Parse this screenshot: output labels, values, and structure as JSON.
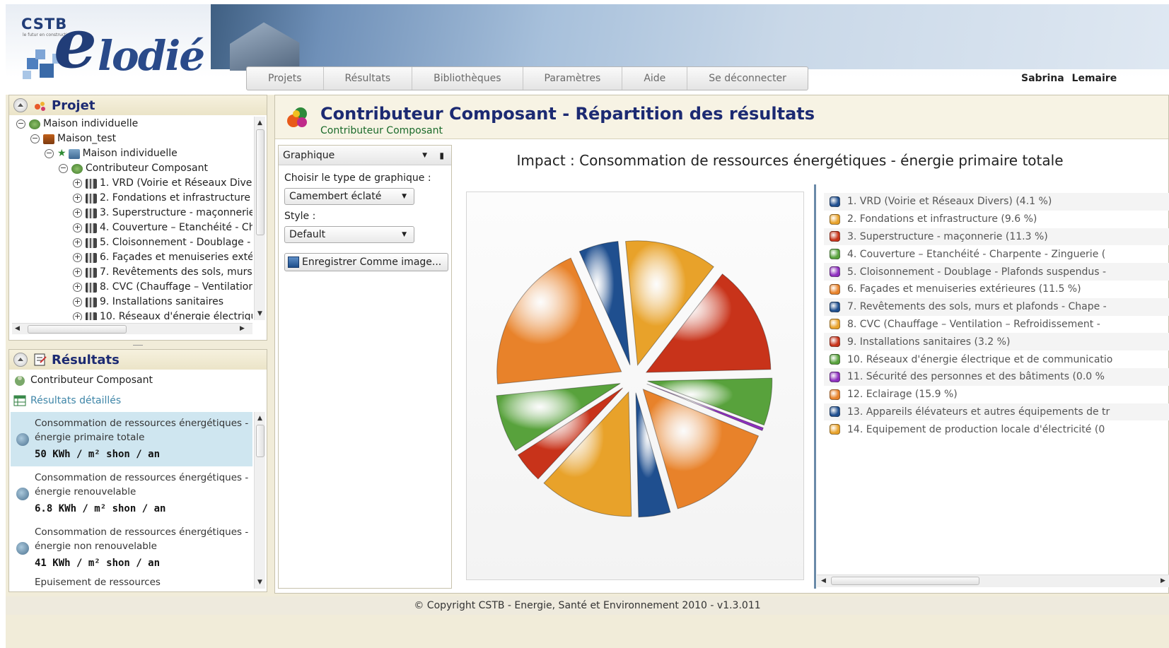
{
  "header": {
    "logo_cstb": "CSTB",
    "logo_tagline": "le futur en construction",
    "logo_e": "e",
    "logo_rest": "lodié",
    "menu": [
      "Projets",
      "Résultats",
      "Bibliothèques",
      "Paramètres",
      "Aide",
      "Se déconnecter"
    ],
    "user": "Sabrina Lemaire"
  },
  "projet": {
    "title": "Projet",
    "tree": [
      {
        "label": "Maison individuelle",
        "level": 0,
        "toggle": "⊖",
        "icon": "project-icon"
      },
      {
        "label": "Maison_test",
        "level": 1,
        "toggle": "⊖",
        "icon": "house-icon"
      },
      {
        "label": "Maison individuelle",
        "level": 2,
        "toggle": "⊖",
        "icon": "building-icon",
        "star": true
      },
      {
        "label": "Contributeur Composant",
        "level": 3,
        "toggle": "⊖",
        "icon": "component-icon"
      },
      {
        "label": "1. VRD (Voirie et Réseaux Dive",
        "level": 4,
        "toggle": "⊕",
        "icon": "book-icon"
      },
      {
        "label": "2. Fondations et infrastructure",
        "level": 4,
        "toggle": "⊕",
        "icon": "book-icon"
      },
      {
        "label": "3. Superstructure - maçonnerie",
        "level": 4,
        "toggle": "⊕",
        "icon": "book-icon"
      },
      {
        "label": "4. Couverture – Etanchéité - Ch",
        "level": 4,
        "toggle": "⊕",
        "icon": "book-icon"
      },
      {
        "label": "5. Cloisonnement - Doublage -",
        "level": 4,
        "toggle": "⊕",
        "icon": "book-icon"
      },
      {
        "label": "6. Façades et menuiseries exté",
        "level": 4,
        "toggle": "⊕",
        "icon": "book-icon"
      },
      {
        "label": "7. Revêtements des sols, murs",
        "level": 4,
        "toggle": "⊕",
        "icon": "book-icon"
      },
      {
        "label": "8. CVC (Chauffage – Ventilation",
        "level": 4,
        "toggle": "⊕",
        "icon": "book-icon"
      },
      {
        "label": "9. Installations sanitaires",
        "level": 4,
        "toggle": "⊕",
        "icon": "book-icon"
      },
      {
        "label": "10. Réseaux d'énergie électriqu",
        "level": 4,
        "toggle": "⊕",
        "icon": "book-icon"
      }
    ]
  },
  "resultats": {
    "title": "Résultats",
    "link_component": "Contributeur Composant",
    "link_detailed": "Résultats détaillés",
    "items": [
      {
        "label": "Consommation de ressources énergétiques - énergie primaire totale",
        "value": "50 KWh / m² shon / an",
        "selected": true
      },
      {
        "label": "Consommation de ressources énergétiques - énergie renouvelable",
        "value": "6.8 KWh / m² shon / an",
        "selected": false
      },
      {
        "label": "Consommation de ressources énergétiques - énergie non renouvelable",
        "value": "41 KWh / m² shon / an",
        "selected": false
      },
      {
        "label": "Epuisement de ressources",
        "value": "",
        "selected": false
      }
    ]
  },
  "main": {
    "title": "Contributeur Composant - Répartition des résultats",
    "subtitle": "Contributeur Composant",
    "options": {
      "header": "Graphique",
      "chart_type_label": "Choisir le type de graphique :",
      "chart_type_value": "Camembert éclaté",
      "style_label": "Style :",
      "style_value": "Default",
      "save_button": "Enregistrer Comme image..."
    },
    "impact_title": "Impact : Consommation de ressources énergétiques - énergie primaire totale"
  },
  "chart_data": {
    "type": "pie",
    "exploded": true,
    "title": "Impact : Consommation de ressources énergétiques - énergie primaire totale",
    "legend_position": "right",
    "slices": [
      {
        "label": "1. VRD (Voirie et Réseaux Divers) (4.1 %)",
        "value": 4.1,
        "color": "#1f4f8f"
      },
      {
        "label": "2. Fondations et infrastructure (9.6 %)",
        "value": 9.6,
        "color": "#e8a22a"
      },
      {
        "label": "3. Superstructure - maçonnerie (11.3 %)",
        "value": 11.3,
        "color": "#c8331a"
      },
      {
        "label": "4. Couverture – Etanchéité - Charpente - Zinguerie (",
        "value": 4.9,
        "color": "#58a23c"
      },
      {
        "label": "5. Cloisonnement - Doublage - Plafonds suspendus -",
        "value": 0.3,
        "color": "#8e2fbf"
      },
      {
        "label": "6. Façades et menuiseries extérieures (11.5 %)",
        "value": 11.5,
        "color": "#e8822a"
      },
      {
        "label": "7. Revêtements des sols, murs et plafonds - Chape -",
        "value": 3.3,
        "color": "#1f4f8f"
      },
      {
        "label": "8. CVC (Chauffage – Ventilation – Refroidissement -",
        "value": 9.8,
        "color": "#e8a22a"
      },
      {
        "label": "9. Installations sanitaires (3.2 %)",
        "value": 3.2,
        "color": "#c8331a"
      },
      {
        "label": "10. Réseaux d'énergie électrique et de communicatio",
        "value": 6.0,
        "color": "#58a23c"
      },
      {
        "label": "11. Sécurité des personnes et des bâtiments  (0.0 %",
        "value": 0.0,
        "color": "#8e2fbf"
      },
      {
        "label": "12. Eclairage (15.9 %)",
        "value": 15.9,
        "color": "#e8822a"
      },
      {
        "label": "13. Appareils élévateurs et autres équipements de tr",
        "value": 0.0,
        "color": "#1f4f8f"
      },
      {
        "label": "14. Equipement de production locale d'électricité (0 ",
        "value": 0.0,
        "color": "#e8a22a"
      }
    ]
  },
  "footer": "© Copyright CSTB - Energie, Santé et Environnement 2010 - v1.3.011"
}
